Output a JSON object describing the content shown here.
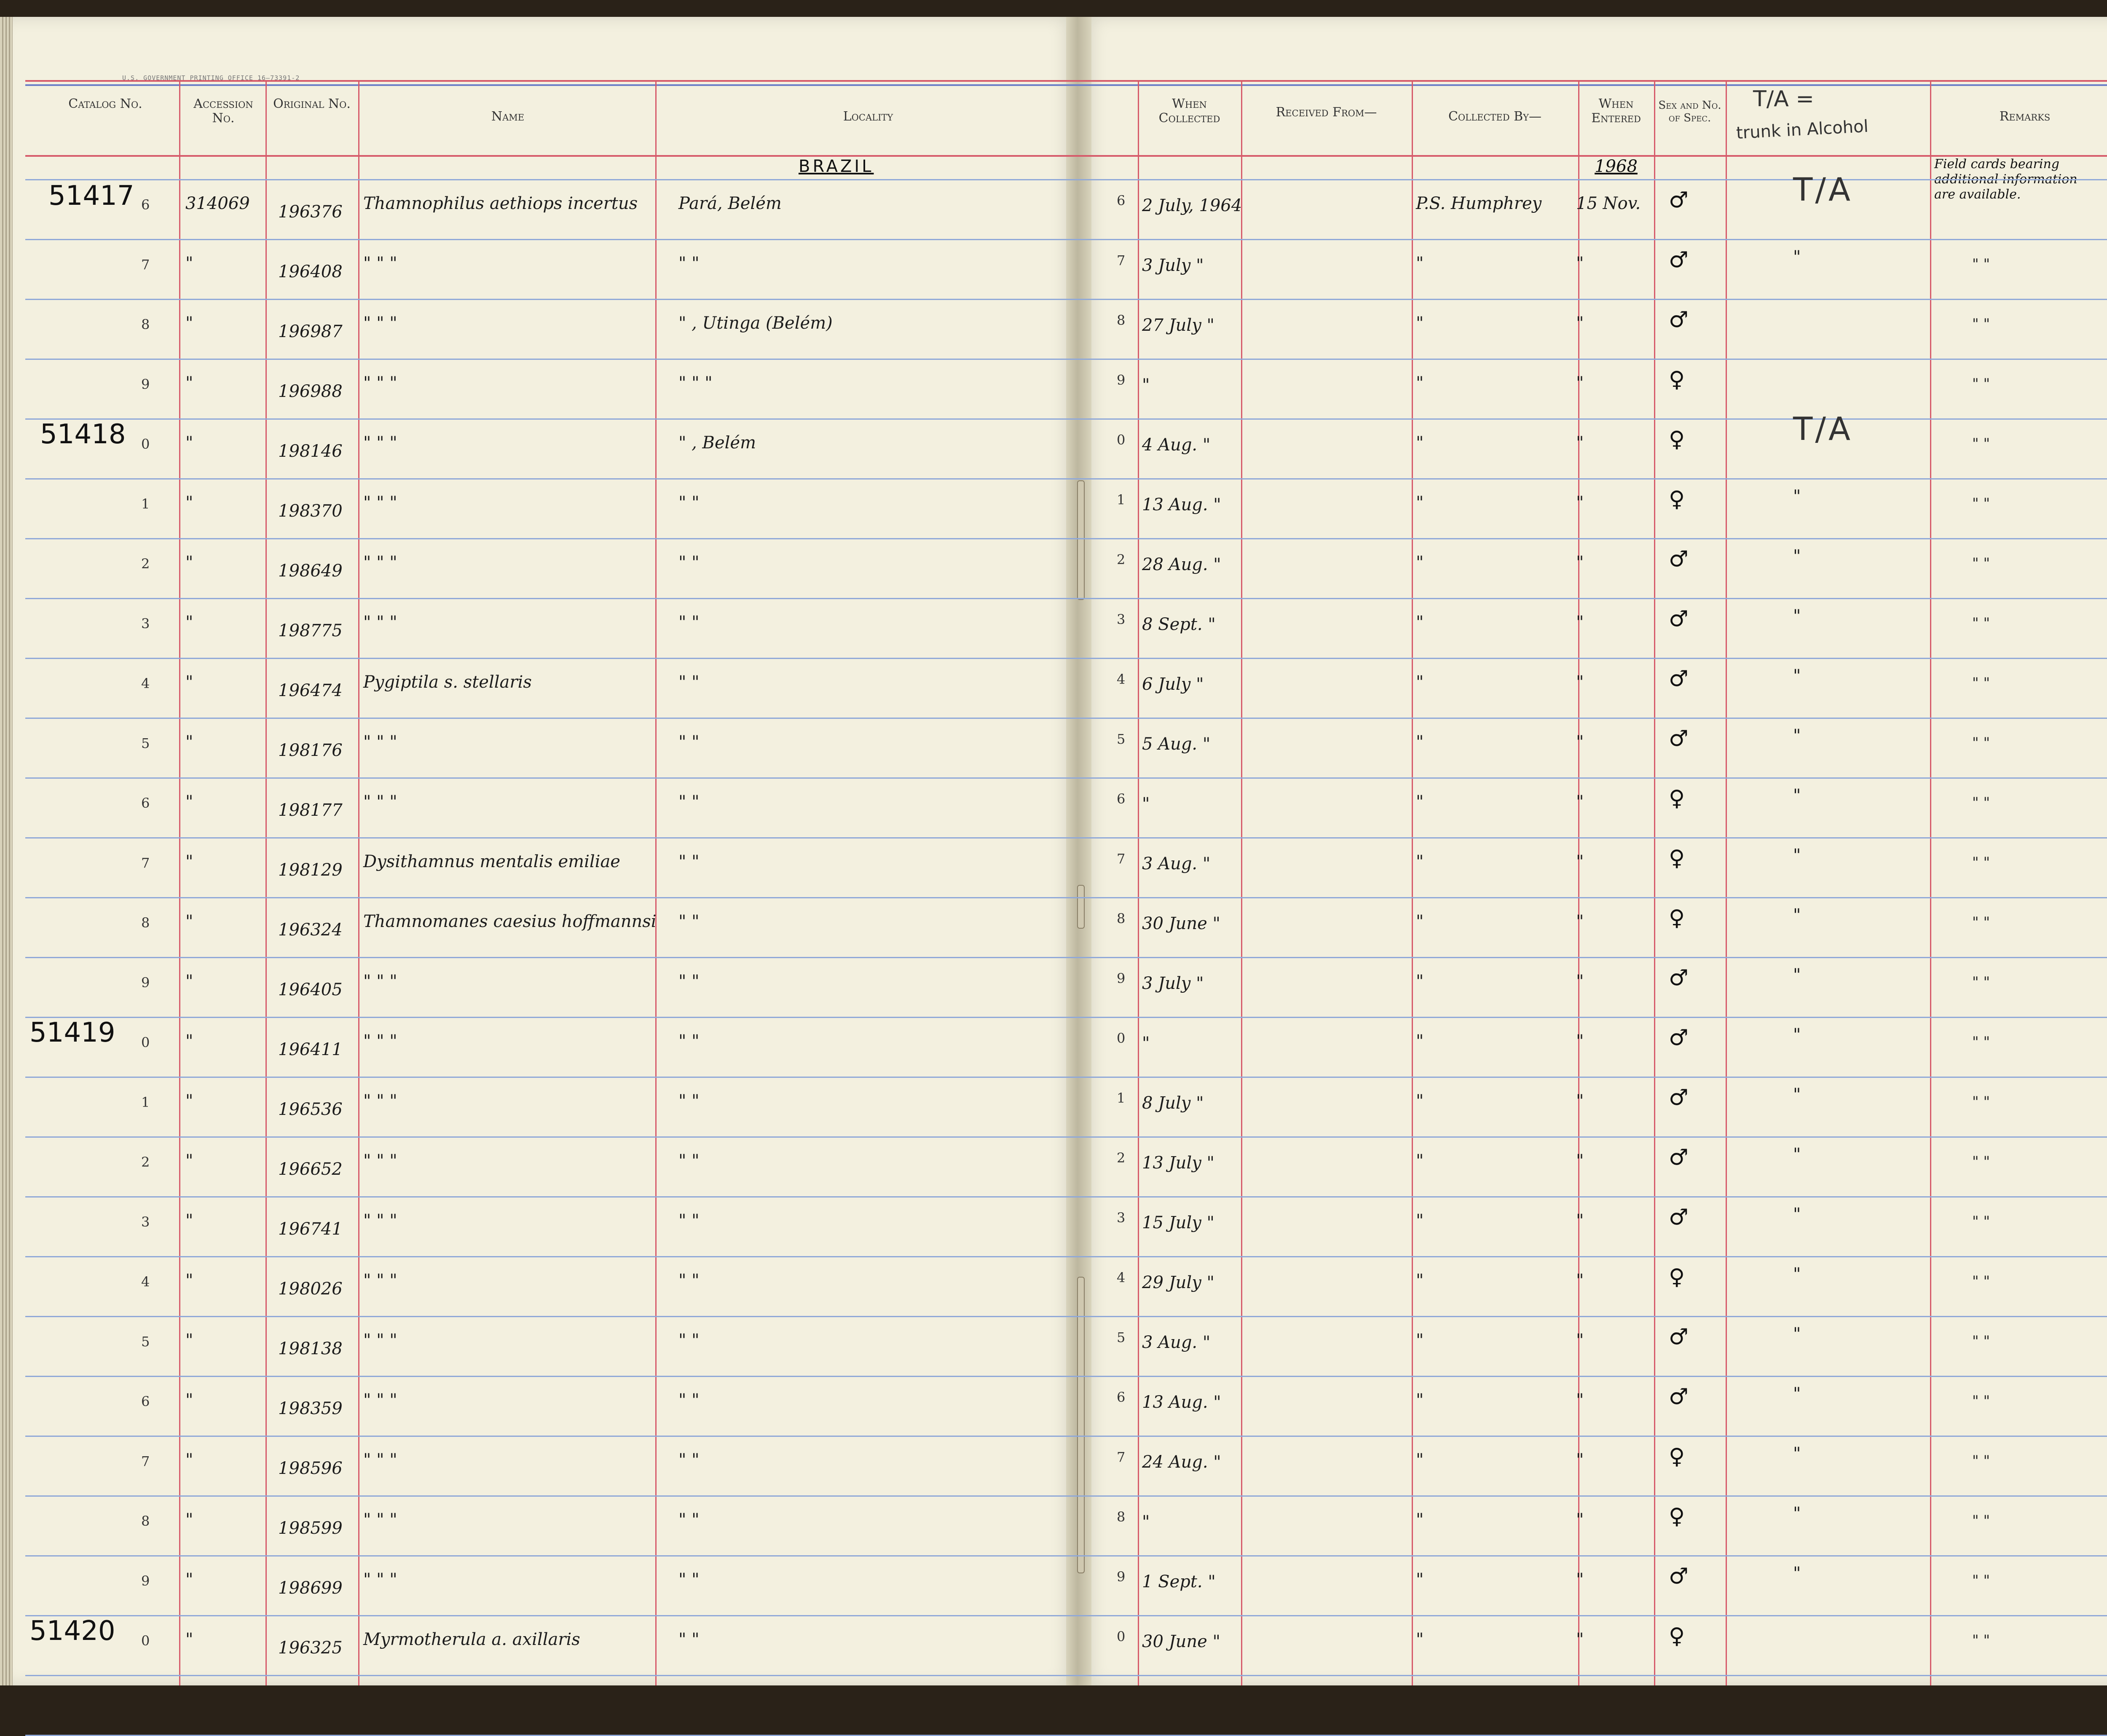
{
  "printer_mark": "U.S. GOVERNMENT PRINTING OFFICE   16—73391-2",
  "headers": {
    "catalog": "Catalog No.",
    "accession": "Accession No.",
    "original": "Original No.",
    "name": "Name",
    "locality": "Locality",
    "when_collected": "When Collected",
    "received_from": "Received From—",
    "collected_by": "Collected By—",
    "when_entered": "When Entered",
    "sex": "Sex and No. of Spec.",
    "remarks": "Remarks"
  },
  "top_note": {
    "line1": "T/A =",
    "line2": "trunk in Alcohol"
  },
  "country": "BRAZIL",
  "entered_year": "1968",
  "remarks_note": [
    "Field cards bearing",
    "additional information",
    "are available."
  ],
  "catalog_blocks": [
    "51417",
    "51418",
    "51419",
    "51420"
  ],
  "rows": [
    {
      "d": "6",
      "acc": "314069",
      "orig": "196376",
      "name": "Thamnophilus aethiops incertus",
      "loc": "Pará, Belém",
      "date": "2 July, 1964",
      "coll": "P.S. Humphrey",
      "ent": "15 Nov.",
      "sex": "♂",
      "tia": "T/A",
      "rm": ""
    },
    {
      "d": "7",
      "acc": "\"",
      "orig": "196408",
      "name": "\"   \"   \"",
      "loc": "\"   \"",
      "date": "3 July \"",
      "coll": "\"",
      "ent": "\"",
      "sex": "♂",
      "tia": "\"",
      "rm": "\"   \""
    },
    {
      "d": "8",
      "acc": "\"",
      "orig": "196987",
      "name": "\"   \"   \"",
      "loc": "\" , Utinga (Belém)",
      "date": "27 July \"",
      "coll": "\"",
      "ent": "\"",
      "sex": "♂",
      "tia": "",
      "rm": "\"   \""
    },
    {
      "d": "9",
      "acc": "\"",
      "orig": "196988",
      "name": "\"   \"   \"",
      "loc": "\"   \"   \"",
      "date": "\"",
      "coll": "\"",
      "ent": "\"",
      "sex": "♀",
      "tia": "",
      "rm": "\"   \""
    },
    {
      "d": "0",
      "acc": "\"",
      "orig": "198146",
      "name": "\"   \"   \"",
      "loc": "\" , Belém",
      "date": "4 Aug. \"",
      "coll": "\"",
      "ent": "\"",
      "sex": "♀",
      "tia": "T/A",
      "rm": "\"   \""
    },
    {
      "d": "1",
      "acc": "\"",
      "orig": "198370",
      "name": "\"   \"   \"",
      "loc": "\"   \"",
      "date": "13 Aug. \"",
      "coll": "\"",
      "ent": "\"",
      "sex": "♀",
      "tia": "\"",
      "rm": "\"   \""
    },
    {
      "d": "2",
      "acc": "\"",
      "orig": "198649",
      "name": "\"   \"   \"",
      "loc": "\"   \"",
      "date": "28 Aug. \"",
      "coll": "\"",
      "ent": "\"",
      "sex": "♂",
      "tia": "\"",
      "rm": "\"   \""
    },
    {
      "d": "3",
      "acc": "\"",
      "orig": "198775",
      "name": "\"   \"   \"",
      "loc": "\"   \"",
      "date": "8 Sept. \"",
      "coll": "\"",
      "ent": "\"",
      "sex": "♂",
      "tia": "\"",
      "rm": "\"   \""
    },
    {
      "d": "4",
      "acc": "\"",
      "orig": "196474",
      "name": "Pygiptila s. stellaris",
      "loc": "\"   \"",
      "date": "6 July \"",
      "coll": "\"",
      "ent": "\"",
      "sex": "♂",
      "tia": "\"",
      "rm": "\"   \""
    },
    {
      "d": "5",
      "acc": "\"",
      "orig": "198176",
      "name": "\"   \"   \"",
      "loc": "\"   \"",
      "date": "5 Aug. \"",
      "coll": "\"",
      "ent": "\"",
      "sex": "♂",
      "tia": "\"",
      "rm": "\"   \""
    },
    {
      "d": "6",
      "acc": "\"",
      "orig": "198177",
      "name": "\"   \"   \"",
      "loc": "\"   \"",
      "date": "\"",
      "coll": "\"",
      "ent": "\"",
      "sex": "♀",
      "tia": "\"",
      "rm": "\"   \""
    },
    {
      "d": "7",
      "acc": "\"",
      "orig": "198129",
      "name": "Dysithamnus mentalis emiliae",
      "loc": "\"   \"",
      "date": "3 Aug. \"",
      "coll": "\"",
      "ent": "\"",
      "sex": "♀",
      "tia": "\"",
      "rm": "\"   \""
    },
    {
      "d": "8",
      "acc": "\"",
      "orig": "196324",
      "name": "Thamnomanes caesius hoffmannsi",
      "loc": "\"   \"",
      "date": "30 June \"",
      "coll": "\"",
      "ent": "\"",
      "sex": "♀",
      "tia": "\"",
      "rm": "\"   \""
    },
    {
      "d": "9",
      "acc": "\"",
      "orig": "196405",
      "name": "\"   \"   \"",
      "loc": "\"   \"",
      "date": "3 July \"",
      "coll": "\"",
      "ent": "\"",
      "sex": "♂",
      "tia": "\"",
      "rm": "\"   \""
    },
    {
      "d": "0",
      "acc": "\"",
      "orig": "196411",
      "name": "\"   \"   \"",
      "loc": "\"   \"",
      "date": "\"",
      "coll": "\"",
      "ent": "\"",
      "sex": "♂",
      "tia": "\"",
      "rm": "\"   \""
    },
    {
      "d": "1",
      "acc": "\"",
      "orig": "196536",
      "name": "\"   \"   \"",
      "loc": "\"   \"",
      "date": "8 July \"",
      "coll": "\"",
      "ent": "\"",
      "sex": "♂",
      "tia": "\"",
      "rm": "\"   \""
    },
    {
      "d": "2",
      "acc": "\"",
      "orig": "196652",
      "name": "\"   \"   \"",
      "loc": "\"   \"",
      "date": "13 July \"",
      "coll": "\"",
      "ent": "\"",
      "sex": "♂",
      "tia": "\"",
      "rm": "\"   \""
    },
    {
      "d": "3",
      "acc": "\"",
      "orig": "196741",
      "name": "\"   \"   \"",
      "loc": "\"   \"",
      "date": "15 July \"",
      "coll": "\"",
      "ent": "\"",
      "sex": "♂",
      "tia": "\"",
      "rm": "\"   \""
    },
    {
      "d": "4",
      "acc": "\"",
      "orig": "198026",
      "name": "\"   \"   \"",
      "loc": "\"   \"",
      "date": "29 July \"",
      "coll": "\"",
      "ent": "\"",
      "sex": "♀",
      "tia": "\"",
      "rm": "\"   \""
    },
    {
      "d": "5",
      "acc": "\"",
      "orig": "198138",
      "name": "\"   \"   \"",
      "loc": "\"   \"",
      "date": "3 Aug. \"",
      "coll": "\"",
      "ent": "\"",
      "sex": "♂",
      "tia": "\"",
      "rm": "\"   \""
    },
    {
      "d": "6",
      "acc": "\"",
      "orig": "198359",
      "name": "\"   \"   \"",
      "loc": "\"   \"",
      "date": "13 Aug. \"",
      "coll": "\"",
      "ent": "\"",
      "sex": "♂",
      "tia": "\"",
      "rm": "\"   \""
    },
    {
      "d": "7",
      "acc": "\"",
      "orig": "198596",
      "name": "\"   \"   \"",
      "loc": "\"   \"",
      "date": "24 Aug. \"",
      "coll": "\"",
      "ent": "\"",
      "sex": "♀",
      "tia": "\"",
      "rm": "\"   \""
    },
    {
      "d": "8",
      "acc": "\"",
      "orig": "198599",
      "name": "\"   \"   \"",
      "loc": "\"   \"",
      "date": "\"",
      "coll": "\"",
      "ent": "\"",
      "sex": "♀",
      "tia": "\"",
      "rm": "\"   \""
    },
    {
      "d": "9",
      "acc": "\"",
      "orig": "198699",
      "name": "\"   \"   \"",
      "loc": "\"   \"",
      "date": "1 Sept. \"",
      "coll": "\"",
      "ent": "\"",
      "sex": "♂",
      "tia": "\"",
      "rm": "\"   \""
    },
    {
      "d": "0",
      "acc": "\"",
      "orig": "196325",
      "name": "Myrmotherula a. axillaris",
      "loc": "\"   \"",
      "date": "30 June \"",
      "coll": "\"",
      "ent": "\"",
      "sex": "♀",
      "tia": "",
      "rm": "\"   \""
    }
  ],
  "colors": {
    "paper": "#f3f0df",
    "blue_rule": "#8fa8d8",
    "red_rule": "#d65a6a",
    "ink": "#1c1c1c"
  }
}
